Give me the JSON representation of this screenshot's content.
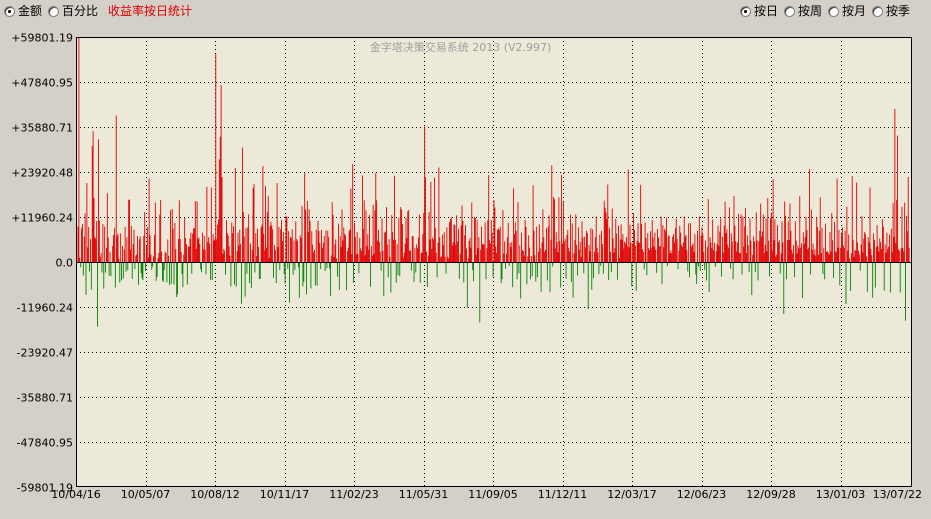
{
  "view_mode": {
    "options": [
      {
        "label": "金额",
        "checked": true
      },
      {
        "label": "百分比",
        "checked": false
      }
    ],
    "title": "收益率按日统计"
  },
  "period": {
    "options": [
      {
        "label": "按日",
        "checked": true
      },
      {
        "label": "按周",
        "checked": false
      },
      {
        "label": "按月",
        "checked": false
      },
      {
        "label": "按季",
        "checked": false
      }
    ]
  },
  "watermark": "金字塔决策交易系统 2013 (V2.997)",
  "colors": {
    "background": "#d4d0c8",
    "plot_background": "#ece9d8",
    "grid": "#000000",
    "positive": "#e00000",
    "negative": "#008000",
    "watermark": "#a0a0a0",
    "title": "#e00000"
  },
  "chart_data": {
    "type": "bar",
    "title": "",
    "xlabel": "",
    "ylabel": "",
    "ylim": [
      -59801.19,
      59801.19
    ],
    "y_ticks": [
      59801.19,
      47840.95,
      35880.71,
      23920.48,
      11960.24,
      0,
      -11960.24,
      -23920.47,
      -35880.71,
      -47840.95,
      -59801.19
    ],
    "y_tick_labels": [
      "+59801.19",
      "+47840.95",
      "+35880.71",
      "+23920.48",
      "+11960.24",
      "0.0",
      "-11960.24",
      "-23920.47",
      "-35880.71",
      "-47840.95",
      "-59801.19"
    ],
    "x_tick_labels": [
      "10/04/16",
      "10/05/07",
      "10/08/12",
      "10/11/17",
      "11/02/23",
      "11/05/31",
      "11/09/05",
      "11/12/11",
      "12/03/17",
      "12/06/23",
      "12/09/28",
      "13/01/03",
      "13/07/22"
    ],
    "grid": true,
    "series": [
      {
        "values": [
          9400,
          59800,
          1200,
          -1400,
          9000,
          10100,
          -3600,
          6700,
          12900,
          -8700,
          21000,
          3900,
          9300,
          -2500,
          6100,
          -7300,
          30800,
          34800,
          17000,
          6600,
          6200,
          10900,
          -17200,
          32600,
          11000,
          1400,
          2400,
          -2800,
          10100,
          -7100,
          9400,
          -2800,
          3800,
          18300,
          6500,
          -3600,
          2600,
          -3800,
          0,
          4300,
          7200,
          9100,
          -6800,
          38900,
          6900,
          7500,
          900,
          -5500,
          7600,
          -4900,
          4200,
          -4400,
          3300,
          9300,
          -2600,
          6600,
          -2200,
          16500,
          16600,
          3300,
          9600,
          -4500,
          4700,
          8600,
          -1900,
          1700,
          2000,
          6900,
          -6100,
          6000,
          6800,
          -3000,
          -4300,
          -4800,
          6900,
          13300,
          -2400,
          4200,
          9300,
          1200,
          22200,
          7100,
          2000,
          -2000,
          -1200,
          1500,
          7200,
          15800,
          -5000,
          -3900,
          1100,
          2400,
          12600,
          16500,
          2800,
          -4900,
          -5300,
          -2100,
          2700,
          2400,
          -5400,
          6000,
          1600,
          -6100,
          13800,
          -5800,
          14100,
          8900,
          -6000,
          10400,
          3400,
          -9300,
          -8600,
          6100,
          16400,
          6100,
          2700,
          -3200,
          -6700,
          2000,
          11800,
          6400,
          4700,
          -6000,
          4200,
          4000,
          6200,
          7800,
          -3100,
          7500,
          8900,
          9000,
          16200,
          3500,
          16100,
          6100,
          6500,
          4800,
          -1900,
          -2700,
          7800,
          3300,
          7000,
          3300,
          -3300,
          20000,
          5300,
          6600,
          4900,
          -4700,
          19800,
          -4800,
          7400,
          5700,
          6200,
          55400,
          6000,
          9900,
          11300,
          27300,
          33300,
          47000,
          22600,
          2200,
          3500,
          3000,
          -3400,
          11100,
          7700,
          7000,
          4200,
          1700,
          -6500,
          10500,
          7700,
          9500,
          -6000,
          25000,
          -6600,
          2900,
          7800,
          4400,
          8600,
          4800,
          -11100,
          30400,
          13300,
          6800,
          -9200,
          9000,
          -3100,
          9200,
          12700,
          -5600,
          4900,
          -6900,
          3200,
          19600,
          20700,
          -2800,
          7700,
          1600,
          8800,
          4000,
          -4500,
          -4500,
          9200,
          9900,
          25500,
          7500,
          3100,
          20200,
          3800,
          13300,
          17600,
          1100,
          9500,
          10700,
          9700,
          8700,
          -4200,
          4500,
          3200,
          -5600,
          21000,
          4000,
          9300,
          -2100,
          8700,
          11200,
          5600,
          8000,
          -3200,
          -5700,
          12300,
          12000,
          -1800,
          8200,
          -10800,
          6700,
          6300,
          8700,
          -3400,
          5700,
          -2100,
          10800,
          6100,
          5600,
          -1400,
          -9500,
          7100,
          6400,
          14900,
          -6500,
          -5300,
          23600,
          13900,
          -8600,
          16200,
          8000,
          14000,
          11000,
          -7000,
          8200,
          4600,
          2600,
          3200,
          -6200,
          8600,
          -6300,
          11000,
          8200,
          5100,
          -1900,
          8500,
          3700,
          5100,
          6900,
          -2400,
          8400,
          -1700,
          8300,
          6600,
          -1700,
          -9000,
          1700,
          15900,
          12500,
          1300,
          4700,
          6000,
          1000,
          -3900,
          10200,
          -7400,
          6900,
          4000,
          14000,
          5700,
          9200,
          7500,
          7100,
          -7500,
          2900,
          3800,
          8200,
          8700,
          19500,
          2100,
          26000,
          -5500,
          10400,
          6700,
          2100,
          8000,
          2100,
          -3000,
          6400,
          3600,
          3000,
          23000,
          8800,
          16400,
          1800,
          13700,
          4300,
          7400,
          3300,
          12500,
          -6600,
          4300,
          1700,
          15200,
          2200,
          13700,
          23600,
          16400,
          5700,
          8500,
          5300,
          2700,
          -2300,
          11600,
          3000,
          -9100,
          7800,
          8100,
          14600,
          4600,
          -4100,
          6100,
          1400,
          -8100,
          12500,
          8000,
          5900,
          22900,
          5900,
          -5500,
          4700,
          -3500,
          11700,
          -3800,
          14600,
          14000,
          10100,
          1200,
          2500,
          4900,
          11700,
          6400,
          13500,
          13800,
          3000,
          3100,
          -2300,
          6900,
          6800,
          -5300,
          3800,
          -2800,
          4700,
          3700,
          6500,
          12600,
          -5500,
          2400,
          2500,
          7400,
          13100,
          36000,
          22500,
          2800,
          -6600,
          1700,
          13300,
          6000,
          21300,
          3500,
          6500,
          6000,
          22400,
          9000,
          2500,
          -4100,
          5100,
          25100,
          6600,
          1200,
          1500,
          7300,
          4500,
          7900,
          1400,
          -3100,
          9200,
          1400,
          1000,
          10600,
          11400,
          11800,
          4400,
          5200,
          10000,
          9800,
          4600,
          12400,
          5500,
          8800,
          -4500,
          2200,
          9700,
          15000,
          10900,
          -5400,
          7100,
          9800,
          3600,
          -12100,
          1000,
          5600,
          6400,
          3800,
          15800,
          -2100,
          -5100,
          12000,
          11700,
          1900,
          11200,
          3700,
          6600,
          -16100,
          3300,
          9400,
          4800,
          4800,
          4500,
          10500,
          -4600,
          3700,
          11100,
          23100,
          5800,
          4900,
          11200,
          7800,
          -3900,
          16400,
          14500,
          4100,
          2400,
          8600,
          8900,
          8500,
          9400,
          -5600,
          -4600,
          13800,
          2300,
          5500,
          -1800,
          2200,
          6600,
          10400,
          -1100,
          5100,
          4000,
          5300,
          -6700,
          19600,
          7400,
          10500,
          8300,
          -4600,
          15900,
          -3000,
          4400,
          -9700,
          7800,
          3200,
          2900,
          1700,
          11200,
          9300,
          -5900,
          1500,
          7100,
          3800,
          -4600,
          1600,
          -3800,
          20400,
          8300,
          1800,
          -5200,
          9400,
          -4000,
          2700,
          10000,
          3600,
          -7900,
          5200,
          14000,
          6600,
          2700,
          3300,
          9000,
          -4900,
          9400,
          12400,
          -8000,
          5900,
          25700,
          -1200,
          17300,
          16700,
          3600,
          7900,
          5300,
          2600,
          17200,
          5600,
          -6800,
          23200,
          4900,
          16200,
          5400,
          6200,
          -4500,
          7200,
          8500,
          3700,
          2800,
          12600,
          -5300,
          10300,
          -9500,
          2300,
          5800,
          12600,
          4500,
          -3600,
          9200,
          3300,
          5400,
          1300,
          10800,
          6500,
          -3000,
          6700,
          3900,
          8300,
          7700,
          -12500,
          4500,
          2900,
          9000,
          -7400,
          8700,
          -4300,
          2700,
          6600,
          12100,
          3800,
          2500,
          -3200,
          7300,
          -1000,
          8300,
          4800,
          -3100,
          16300,
          14400,
          13200,
          11400,
          20600,
          -4800,
          9000,
          2700,
          -2700,
          14200,
          6300,
          2500,
          3700,
          11500,
          7600,
          -4700,
          9700,
          1100,
          6000,
          10000,
          5900,
          7400,
          3600,
          5500,
          5000,
          6600,
          4200,
          24600,
          3900,
          9900,
          5200,
          -6500,
          5000,
          13000,
          8600,
          4400,
          -7600,
          5600,
          10300,
          5200,
          5000,
          20500,
          10100,
          3400,
          2700,
          -2000,
          10500,
          6400,
          -3500,
          7700,
          3700,
          3200,
          8200,
          3700,
          11100,
          6500,
          4100,
          7800,
          3200,
          -2900,
          8800,
          6500,
          4100,
          4300,
          12100,
          -5900,
          9800,
          4000,
          8800,
          8300,
          11800,
          -1100,
          6800,
          7100,
          2400,
          3100,
          2300,
          6700,
          7400,
          5200,
          9000,
          11500,
          6100,
          -1900,
          3000,
          9600,
          7800,
          4600,
          4000,
          5200,
          12100,
          6700,
          7200,
          3100,
          -2500,
          10300,
          -4100,
          10300,
          4100,
          4500,
          5000,
          2700,
          7400,
          -3300,
          -5800,
          8300,
          -1200,
          12100,
          -2400,
          7000,
          9200,
          7300,
          2600,
          -2100,
          5700,
          -4900,
          4000,
          16700,
          -8000,
          6600,
          5200,
          3700,
          11300,
          3100,
          5100,
          -1300,
          2800,
          4800,
          9700,
          4300,
          8100,
          11600,
          -3900,
          6700,
          2500,
          9700,
          16000,
          7700,
          8700,
          4600,
          3800,
          14500,
          -1800,
          7600,
          5400,
          -4600,
          17500,
          9600,
          5500,
          2800,
          5200,
          12800,
          2400,
          2400,
          12600,
          -3300,
          12100,
          4100,
          9500,
          14300,
          2400,
          7100,
          4500,
          -2600,
          11600,
          5700,
          -8800,
          1900,
          6800,
          5500,
          -2700,
          13200,
          5700,
          -4900,
          5500,
          8300,
          15500,
          6800,
          8100,
          12600,
          2400,
          4600,
          11600,
          2900,
          17000,
          5700,
          -3800,
          11700,
          13100,
          3000,
          22000,
          5800,
          11300,
          1400,
          2000,
          9800,
          5300,
          5800,
          -3100,
          2300,
          10800,
          5200,
          -13800,
          16100,
          12300,
          -4600,
          5800,
          10800,
          5900,
          15500,
          8300,
          3200,
          2300,
          4500,
          -4000,
          10800,
          5700,
          2300,
          4400,
          3600,
          17500,
          3800,
          5000,
          -9600,
          7900,
          4800,
          6600,
          12000,
          8500,
          3400,
          3800,
          24700,
          -3300,
          13900,
          3200,
          4900,
          2000,
          3400,
          1700,
          11900,
          9300,
          1900,
          8300,
          17200,
          2400,
          9100,
          -3200,
          3800,
          -4600,
          10200,
          2700,
          2900,
          2500,
          2000,
          8000,
          2800,
          13000,
          5800,
          -4200,
          10700,
          2900,
          2600,
          22200,
          3800,
          8600,
          -6200,
          3800,
          7500,
          9200,
          4400,
          3700,
          8300,
          -11200,
          14700,
          3000,
          7300,
          1000,
          -7700,
          2300,
          22800,
          5900,
          1400,
          3100,
          3100,
          21100,
          5200,
          3000,
          2000,
          -2300,
          4600,
          12200,
          2600,
          6200,
          8000,
          7400,
          1500,
          -7900,
          6600,
          5200,
          19800,
          3400,
          1800,
          -9500,
          7600,
          5900,
          -6800,
          4000,
          9800,
          4200,
          2800,
          6300,
          5300,
          3500,
          11400,
          9400,
          -7600,
          4700,
          2500,
          7800,
          3500,
          4100,
          7300,
          -8100,
          8800,
          2600,
          15700,
          6700,
          40700,
          5000,
          16500,
          33600,
          3400,
          3000,
          -8100,
          3600,
          14700,
          3700,
          2800,
          15800,
          -15600,
          12300,
          8200,
          22600,
          3800
        ]
      }
    ]
  }
}
